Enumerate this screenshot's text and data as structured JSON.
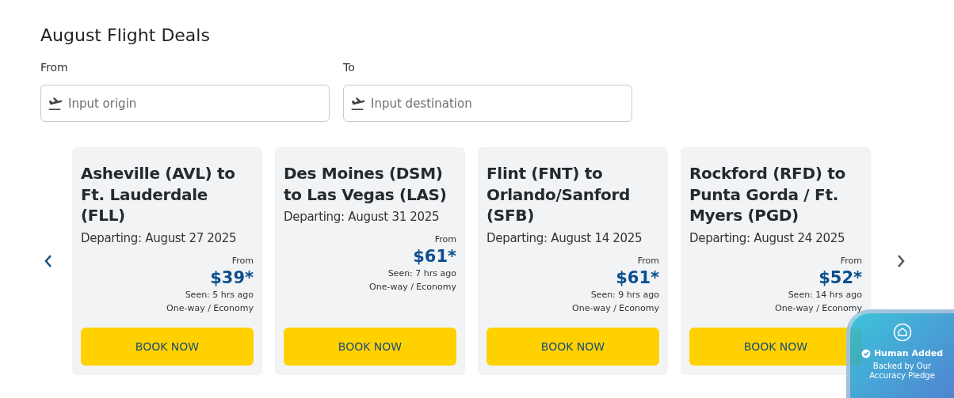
{
  "title": "August Flight Deals",
  "search": {
    "from": {
      "label": "From",
      "placeholder": "Input origin"
    },
    "to": {
      "label": "To",
      "placeholder": "Input destination"
    }
  },
  "deals": [
    {
      "route": "Asheville (AVL) to Ft. Lauderdale (FLL)",
      "departing": "Departing: August 27 2025",
      "from_label": "From",
      "price": "$39*",
      "seen": "Seen: 5 hrs ago",
      "fare": "One-way / Economy",
      "button": "BOOK NOW"
    },
    {
      "route": "Des Moines (DSM) to Las Vegas (LAS)",
      "departing": "Departing: August 31 2025",
      "from_label": "From",
      "price": "$61*",
      "seen": "Seen: 7 hrs ago",
      "fare": "One-way / Economy",
      "button": "BOOK NOW"
    },
    {
      "route": "Flint (FNT) to Orlando/Sanford (SFB)",
      "departing": "Departing: August 14 2025",
      "from_label": "From",
      "price": "$61*",
      "seen": "Seen: 9 hrs ago",
      "fare": "One-way / Economy",
      "button": "BOOK NOW"
    },
    {
      "route": "Rockford (RFD) to Punta Gorda / Ft. Myers (PGD)",
      "departing": "Departing: August 24 2025",
      "from_label": "From",
      "price": "$52*",
      "seen": "Seen: 14 hrs ago",
      "fare": "One-way / Economy",
      "button": "BOOK NOW"
    }
  ],
  "badge": {
    "title": "Human Added",
    "subtitle": "Backed by Our Accuracy Pledge"
  }
}
